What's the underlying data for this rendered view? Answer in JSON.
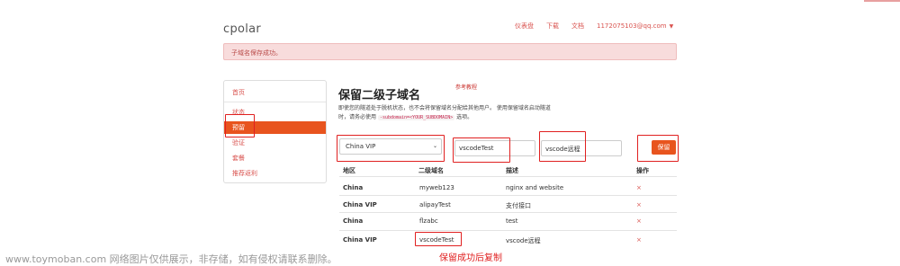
{
  "header": {
    "logo": "cpolar",
    "nav": [
      "仪表盘",
      "下载",
      "文档"
    ],
    "account": "1172075103@qq.com",
    "caret_icon": "caret-down"
  },
  "alert": {
    "message": "子域名保存成功。"
  },
  "sidebar": {
    "items": [
      {
        "label": "首页"
      },
      {
        "label": "状态"
      },
      {
        "label": "预留"
      },
      {
        "label": "验证"
      },
      {
        "label": "套餐"
      },
      {
        "label": "推荐返利"
      }
    ],
    "active_index": 2
  },
  "main": {
    "title": "保留二级子域名",
    "ref_link": "参考教程",
    "desc_line1": "即使您的隧道处于脱机状态，也不会将保留域名分配给其他用户。 使用保留域名启动隧道",
    "desc_line2_pre": "时，请务必使用",
    "desc_code": "-subdomain=<YOUR_SUBDOMAIN>",
    "desc_line2_post": "选项。"
  },
  "form": {
    "region_value": "China VIP",
    "subdomain_value": "vscodeTest",
    "description_value": "vscode远程",
    "save_label": "保留"
  },
  "table": {
    "headers": [
      "地区",
      "二级域名",
      "描述",
      "操作"
    ],
    "rows": [
      {
        "region": "China",
        "subdomain": "myweb123",
        "description": "nginx and website",
        "action": "×"
      },
      {
        "region": "China VIP",
        "subdomain": "alipayTest",
        "description": "支付接口",
        "action": "×"
      },
      {
        "region": "China",
        "subdomain": "flzabc",
        "description": "test",
        "action": "×"
      },
      {
        "region": "China VIP",
        "subdomain": "vscodeTest",
        "description": "vscode远程",
        "action": "×"
      }
    ]
  },
  "annotations": {
    "caption": "保留成功后复制",
    "watermark": "www.toymoban.com 网络图片仅供展示，非存储，如有侵权请联系删除。"
  },
  "colors": {
    "accent": "#e8541e",
    "link": "#d9534f",
    "alert_bg": "#f8dcdc",
    "annotation_red": "#e02020"
  }
}
